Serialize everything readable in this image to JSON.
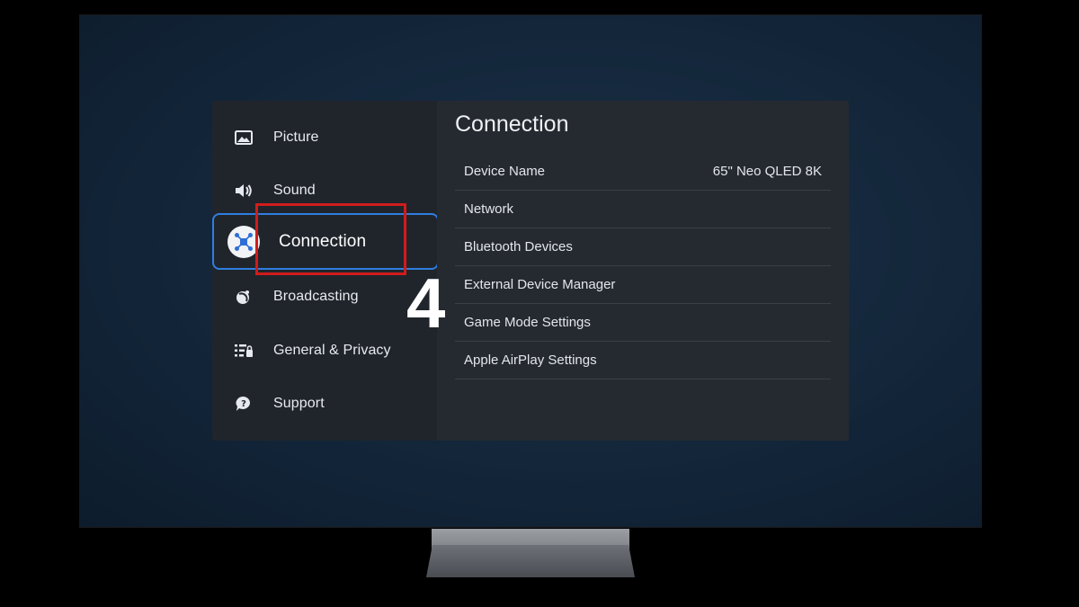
{
  "sidebar": {
    "items": [
      {
        "label": "Picture",
        "icon": "picture-icon"
      },
      {
        "label": "Sound",
        "icon": "speaker-icon"
      },
      {
        "label": "Connection",
        "icon": "connection-icon",
        "active": true
      },
      {
        "label": "Broadcasting",
        "icon": "satellite-dish-icon"
      },
      {
        "label": "General & Privacy",
        "icon": "general-privacy-icon"
      },
      {
        "label": "Support",
        "icon": "help-bubble-icon"
      }
    ]
  },
  "content": {
    "title": "Connection",
    "rows": [
      {
        "label": "Device Name",
        "value": "65\" Neo QLED 8K"
      },
      {
        "label": "Network",
        "value": ""
      },
      {
        "label": "Bluetooth Devices",
        "value": ""
      },
      {
        "label": "External Device Manager",
        "value": ""
      },
      {
        "label": "Game Mode Settings",
        "value": ""
      },
      {
        "label": "Apple AirPlay Settings",
        "value": ""
      }
    ]
  },
  "annotation": {
    "step_number": "4",
    "highlight_color": "#d01c1c",
    "focus_color": "#2f7ee0"
  }
}
